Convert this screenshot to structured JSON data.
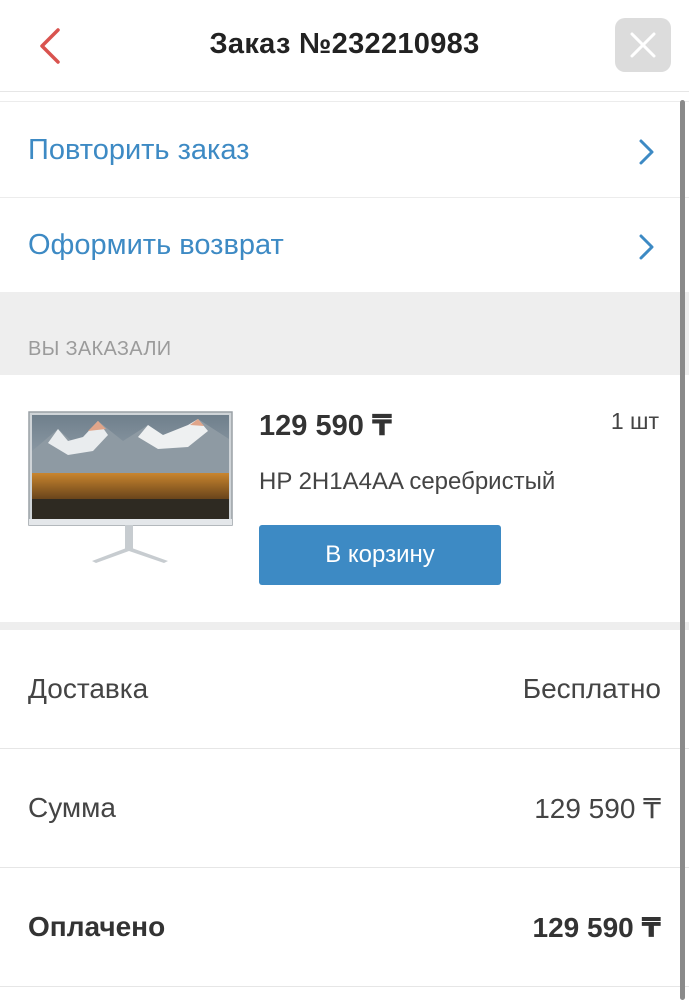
{
  "header": {
    "title": "Заказ №232210983",
    "back_icon": "chevron-left-icon",
    "close_icon": "close-icon"
  },
  "actions": [
    {
      "label": "Повторить заказ"
    },
    {
      "label": "Оформить возврат"
    }
  ],
  "section": {
    "title": "ВЫ ЗАКАЗАЛИ"
  },
  "product": {
    "price": "129 590 ₸",
    "quantity": "1 шт",
    "name": "HP 2H1A4AA серебристый",
    "cart_button": "В корзину",
    "image_icon": "monitor-image"
  },
  "summary": {
    "delivery_label": "Доставка",
    "delivery_value": "Бесплатно",
    "sum_label": "Сумма",
    "sum_value": "129 590 ₸",
    "paid_label": "Оплачено",
    "paid_value": "129 590 ₸"
  },
  "colors": {
    "accent": "#3d8ac4",
    "back_arrow": "#d9534f",
    "section_bg": "#eeeeee"
  }
}
